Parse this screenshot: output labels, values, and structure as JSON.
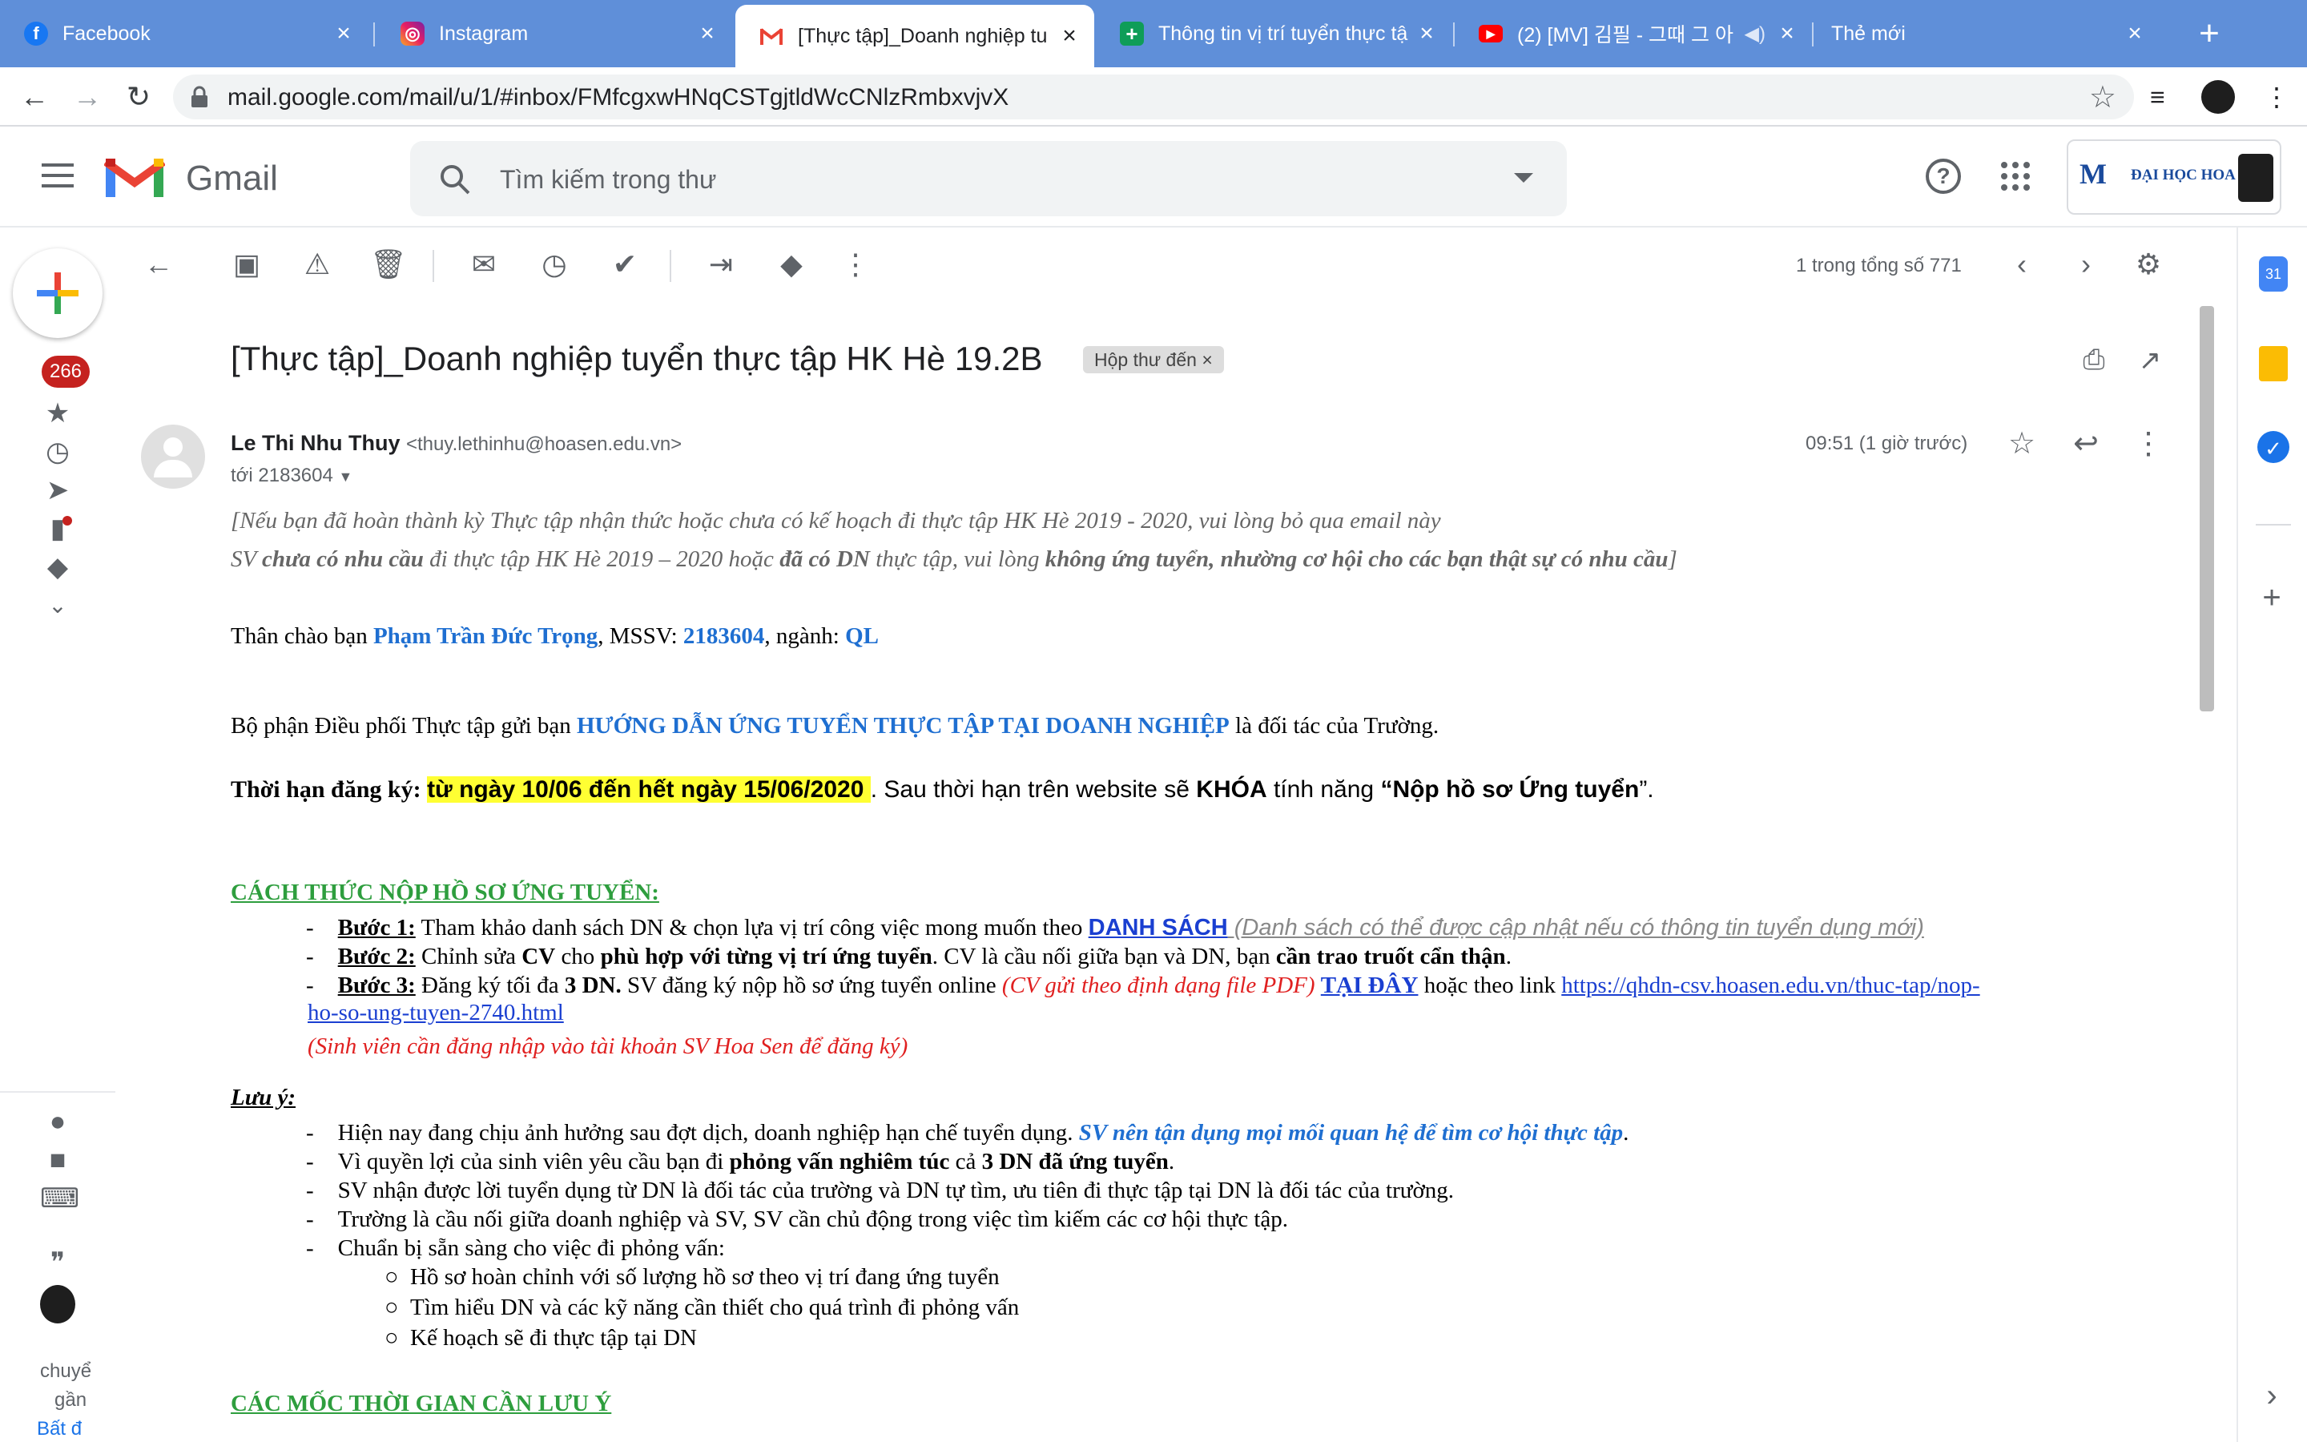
{
  "browser": {
    "tabs": [
      {
        "label": "Facebook",
        "icon": "facebook-icon",
        "color": "#1877f2"
      },
      {
        "label": "Instagram",
        "icon": "instagram-icon",
        "color": "#c13584"
      },
      {
        "label": "[Thực tập]_Doanh nghiệp tu",
        "icon": "gmail-icon",
        "color": "#ea4335",
        "active": true
      },
      {
        "label": "Thông tin vị trí tuyển thực tậ",
        "icon": "sheets-icon",
        "color": "#0f9d58"
      },
      {
        "label": "(2) [MV] 김필 - 그때 그 아",
        "icon": "youtube-icon",
        "color": "#ff0000"
      },
      {
        "label": "Thẻ mới",
        "icon": "",
        "color": ""
      }
    ],
    "url": "mail.google.com/mail/u/1/#inbox/FMfcgxwHNqCSTgjtldWcCNlzRmbxvjvX"
  },
  "gmail": {
    "brand": "Gmail",
    "search_placeholder": "Tìm kiếm trong thư",
    "account_logo_text": "ĐẠI HỌC HOA SEN",
    "unread_count": "266",
    "pager": "1 trong tổng số 771",
    "rail_cut_1": "chuyể",
    "rail_cut_2": "gần",
    "rail_cut_3": "Bất đ"
  },
  "message": {
    "subject": "[Thực tập]_Doanh nghiệp tuyển thực tập HK Hè 19.2B",
    "label": "Hộp thư đến",
    "sender_name": "Le Thi Nhu Thuy",
    "sender_email": "<thuy.lethinhu@hoasen.edu.vn>",
    "to": "tới 2183604",
    "time": "09:51 (1 giờ trước)",
    "note_1": "[Nếu bạn đã hoàn thành kỳ Thực tập nhận thức hoặc chưa có kế hoạch đi thực tập HK Hè 2019 - 2020, vui lòng bỏ qua email này",
    "note_2a": "SV ",
    "note_2b": "chưa có nhu cầu",
    "note_2c": " đi thực tập HK Hè 2019 – 2020 hoặc ",
    "note_2d": "đã có DN",
    "note_2e": " thực tập, vui lòng ",
    "note_2f": "không ứng tuyển, nhường cơ hội cho các bạn thật sự có nhu cầu",
    "note_2g": "]",
    "greet_a": "Thân chào bạn ",
    "greet_name": "Phạm Trần Đức Trọng",
    "greet_b": ", MSSV: ",
    "greet_id": "2183604",
    "greet_c": ", ngành: ",
    "greet_major": "QL",
    "intro_a": "Bộ phận Điều phối Thực tập gửi bạn ",
    "intro_b": "HƯỚNG DẪN ỨNG TUYỂN THỰC TẬP TẠI DOANH NGHIỆP",
    "intro_c": " là đối tác của Trường.",
    "deadline_a": "Thời hạn đăng ký: ",
    "deadline_b": "từ ngày 10/06 đến hết ngày 15/06/2020 ",
    "deadline_c": ". Sau thời hạn trên website sẽ ",
    "deadline_d": "KHÓA",
    "deadline_e": " tính năng ",
    "deadline_f": "“Nộp hồ sơ Ứng tuyển",
    "deadline_g": "”.",
    "sec1": "CÁCH THỨC NỘP HỒ SƠ ỨNG TUYỂN:",
    "s1a": "Bước 1:",
    "s1b": " Tham khảo danh sách DN & chọn lựa vị trí công việc mong muốn theo ",
    "s1c": "DANH SÁCH",
    "s1d": " (Danh sách có thể được cập nhật nếu có thông tin tuyển dụng mới)",
    "s2a": "Bước 2:",
    "s2b": " Chỉnh sửa ",
    "s2c": "CV",
    "s2d": " cho ",
    "s2e": "phù hợp với từng vị trí ứng tuyển",
    "s2f": ". CV là cầu nối giữa bạn và DN, bạn ",
    "s2g": "cần trao truốt cẩn thận",
    "s2h": ".",
    "s3a": "Bước 3:",
    "s3b": " Đăng ký tối đa ",
    "s3c": "3 DN.",
    "s3d": " SV đăng ký nộp hồ sơ ứng tuyển online ",
    "s3e": "(CV gửi theo định dạng file PDF)",
    "s3f": "TẠI ĐÂY",
    "s3g": " hoặc theo link ",
    "s3h": "https://qhdn-csv.hoasen.edu.vn/thuc-tap/nop-",
    "s3i": "ho-so-ung-tuyen-2740.html",
    "s3j": "(Sinh viên cần đăng nhập vào tài khoản SV Hoa Sen để đăng ký)",
    "luuy": "Lưu ý:",
    "n1a": "Hiện nay đang chịu ảnh hưởng sau đợt dịch, doanh nghiệp hạn chế tuyển dụng. ",
    "n1b": "SV nên tận dụng mọi mối quan hệ để tìm cơ hội thực tập",
    "n1c": ".",
    "n2a": "Vì quyền lợi của sinh viên yêu cầu bạn đi ",
    "n2b": "phỏng vấn nghiêm túc",
    "n2c": " cả ",
    "n2d": "3 DN đã ứng tuyển",
    "n2e": ".",
    "n3": "SV nhận được lời tuyển dụng từ DN là đối tác của trường và DN tự tìm, ưu tiên đi thực tập tại DN là đối tác của trường.",
    "n4": "Trường là cầu nối giữa doanh nghiệp và SV, SV cần chủ động trong việc tìm kiếm các cơ hội thực tập.",
    "n5": "Chuẩn bị sẵn sàng cho việc đi phỏng vấn:",
    "sub1": "Hồ sơ hoàn chỉnh với số lượng hồ sơ theo vị trí đang ứng tuyển",
    "sub2": "Tìm hiểu DN và các kỹ năng cần thiết cho quá trình đi phỏng vấn",
    "sub3": "Kế hoạch sẽ đi thực tập tại DN",
    "sec2": "CÁC MỐC THỜI GIAN CẦN LƯU Ý"
  }
}
